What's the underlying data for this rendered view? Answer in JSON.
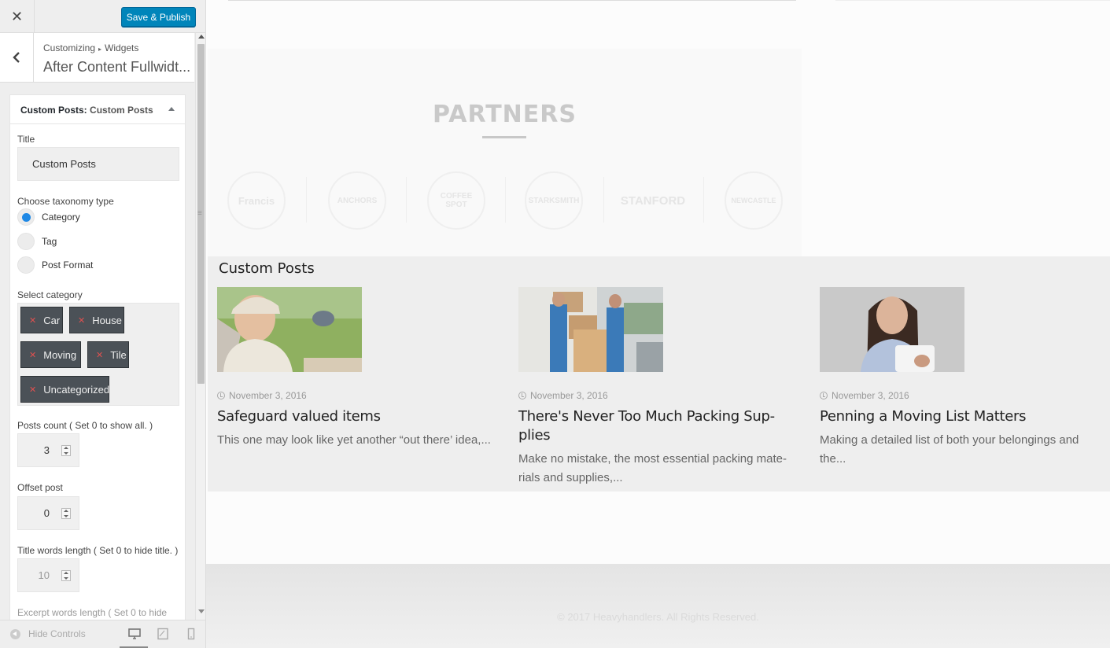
{
  "topbar": {
    "close_icon": "close-icon",
    "publish_label": "Save & Publish"
  },
  "section": {
    "breadcrumb": [
      "Customizing",
      "Widgets"
    ],
    "title": "After Content Fullwidt..."
  },
  "widget": {
    "title_bold": "Custom Posts:",
    "title_sub": "Custom Posts",
    "title_label": "Title",
    "title_value": "Custom Posts",
    "taxonomy_label": "Choose taxonomy type",
    "taxonomy_options": [
      "Category",
      "Tag",
      "Post Format"
    ],
    "taxonomy_selected": "Category",
    "category_label": "Select category",
    "categories": [
      "Car",
      "House",
      "Moving",
      "Tile",
      "Uncategorized"
    ],
    "posts_count_label": "Posts count ( Set 0 to show all. )",
    "posts_count": "3",
    "offset_label": "Offset post",
    "offset": "0",
    "title_words_label": "Title words length ( Set 0 to hide title. )",
    "title_words": "10",
    "excerpt_label": "Excerpt words length ( Set 0 to hide"
  },
  "footer_bar": {
    "hide_controls": "Hide Controls",
    "devices": [
      "desktop-icon",
      "tablet-icon",
      "mobile-icon"
    ]
  },
  "preview": {
    "partners_title": "PARTNERS",
    "partner_logos": [
      "Francis",
      "ANCHORS",
      "COFFEE SPOT",
      "STARKSMITH",
      "STANFORD",
      "NEWCASTLE"
    ],
    "posts_heading": "Custom Posts",
    "posts": [
      {
        "date": "November 3, 2016",
        "title": "Safeguard valued items",
        "excerpt": "This one may look like yet another “out there’ idea,..."
      },
      {
        "date": "November 3, 2016",
        "title": "There's Never Too Much Packing Sup-plies",
        "excerpt": "Make no mistake, the most essential packing mate-rials and supplies,..."
      },
      {
        "date": "November 3, 2016",
        "title": "Penning a Moving List Matters",
        "excerpt": "Making a detailed list of both your belongings and the..."
      }
    ],
    "copyright": "© 2017 Heavyhandlers. All Rights Reserved."
  }
}
